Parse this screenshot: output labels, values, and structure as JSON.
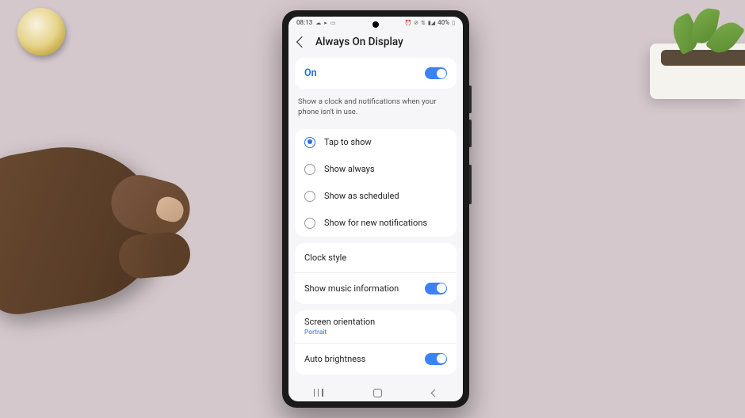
{
  "status_bar": {
    "time": "08:13",
    "battery": "40%"
  },
  "header": {
    "title": "Always On Display"
  },
  "master": {
    "label": "On",
    "on": true
  },
  "description": "Show a clock and notifications when your phone isn't in use.",
  "radio_options": [
    {
      "label": "Tap to show",
      "checked": true
    },
    {
      "label": "Show always",
      "checked": false
    },
    {
      "label": "Show as scheduled",
      "checked": false
    },
    {
      "label": "Show for new notifications",
      "checked": false
    }
  ],
  "items": {
    "clock_style": "Clock style",
    "music_info": "Show music information",
    "orientation_title": "Screen orientation",
    "orientation_value": "Portrait",
    "auto_brightness": "Auto brightness"
  }
}
